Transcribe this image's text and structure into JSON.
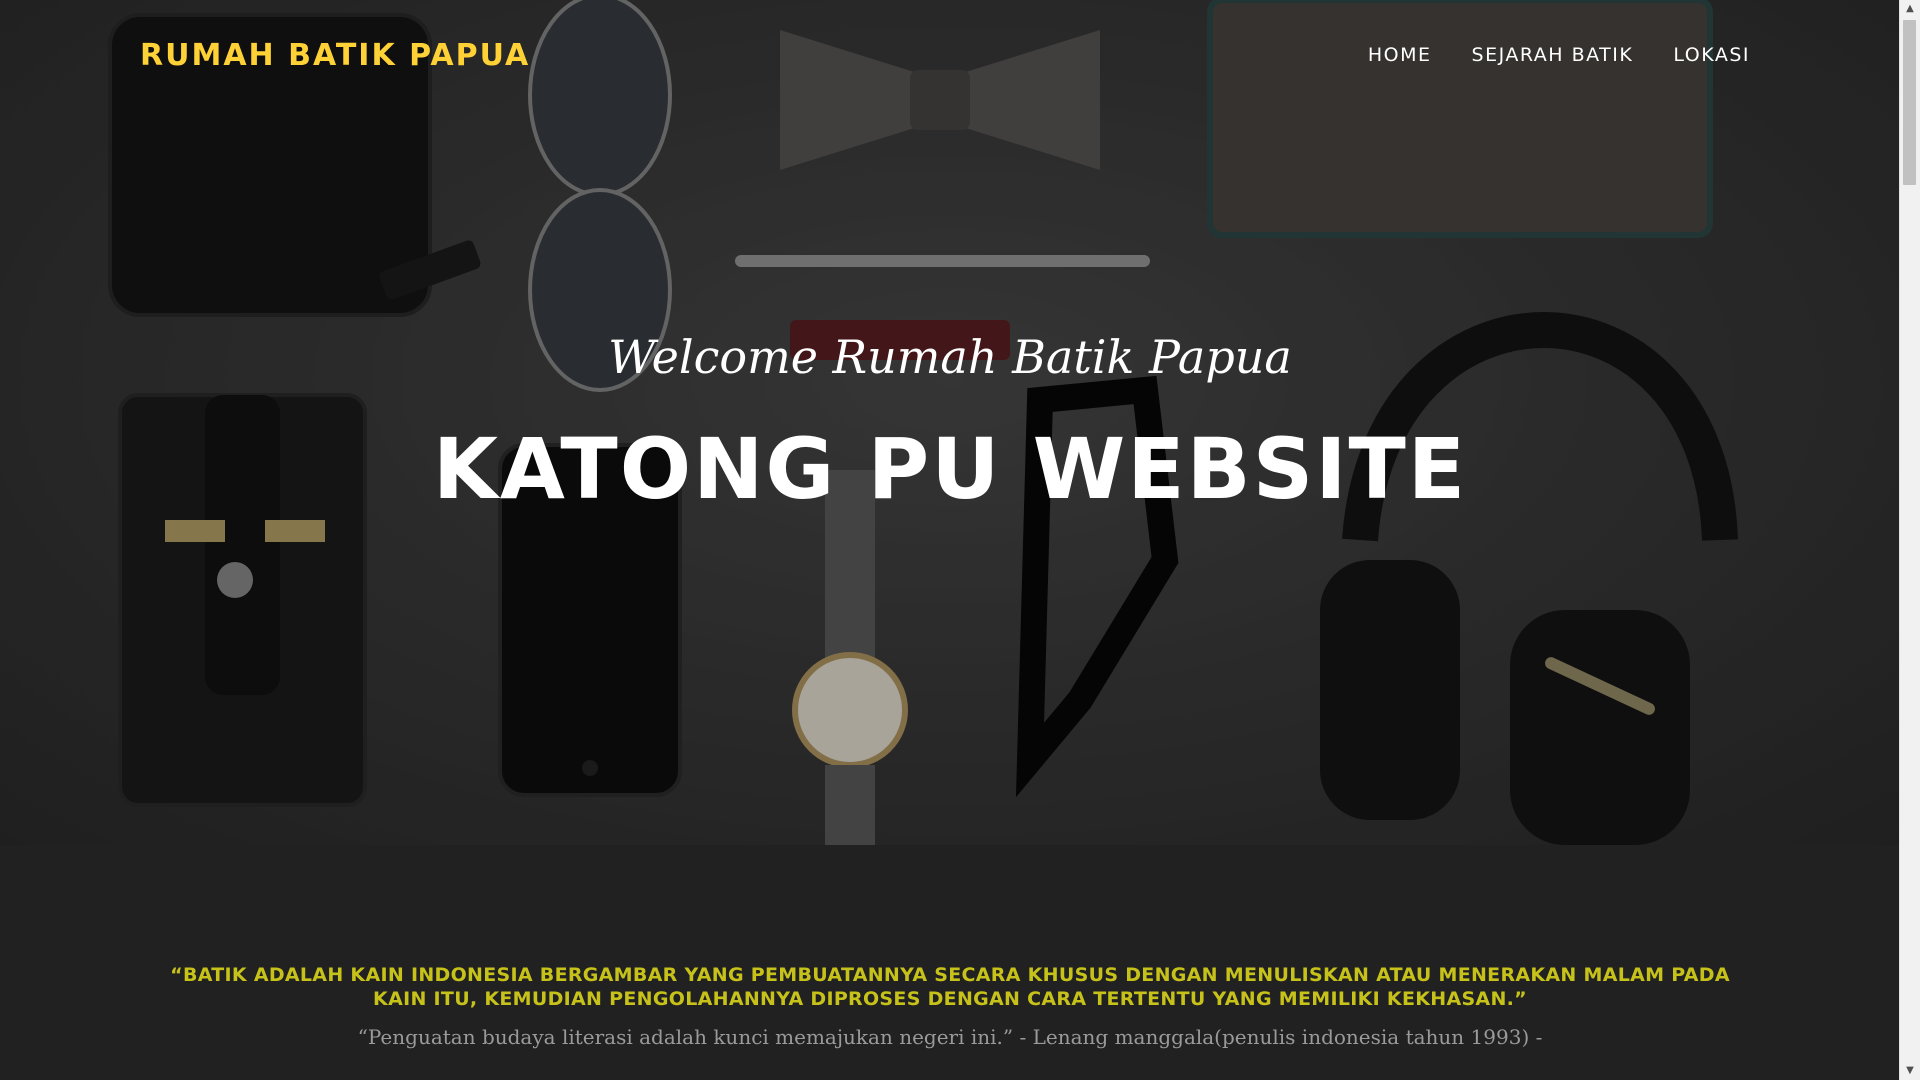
{
  "brand": {
    "name": "RUMAH BATIK PAPUA",
    "color": "#fed136"
  },
  "nav": {
    "items": [
      {
        "label": "HOME"
      },
      {
        "label": "SEJARAH BATIK"
      },
      {
        "label": "LOKASI"
      }
    ]
  },
  "hero": {
    "subtitle": "Welcome Rumah Batik Papua",
    "title": "KATONG PU WEBSITE",
    "background_image": "flat-lay-accessories"
  },
  "quote_section": {
    "quote": "“BATIK ADALAH KAIN INDONESIA BERGAMBAR YANG PEMBUATANNYA SECARA KHUSUS DENGAN MENULISKAN ATAU MENERAKAN MALAM PADA KAIN ITU, KEMUDIAN PENGOLAHANNYA DIPROSES DENGAN CARA TERTENTU YANG MEMILIKI KEKHASAN.”",
    "citation": "“Penguatan budaya literasi adalah kunci memajukan negeri ini.” - Lenang manggala(penulis indonesia tahun 1993) -",
    "accent_color": "#c7c21a"
  },
  "icons": {
    "scroll_up": "chevron-up-icon",
    "scroll_down": "chevron-down-icon"
  }
}
